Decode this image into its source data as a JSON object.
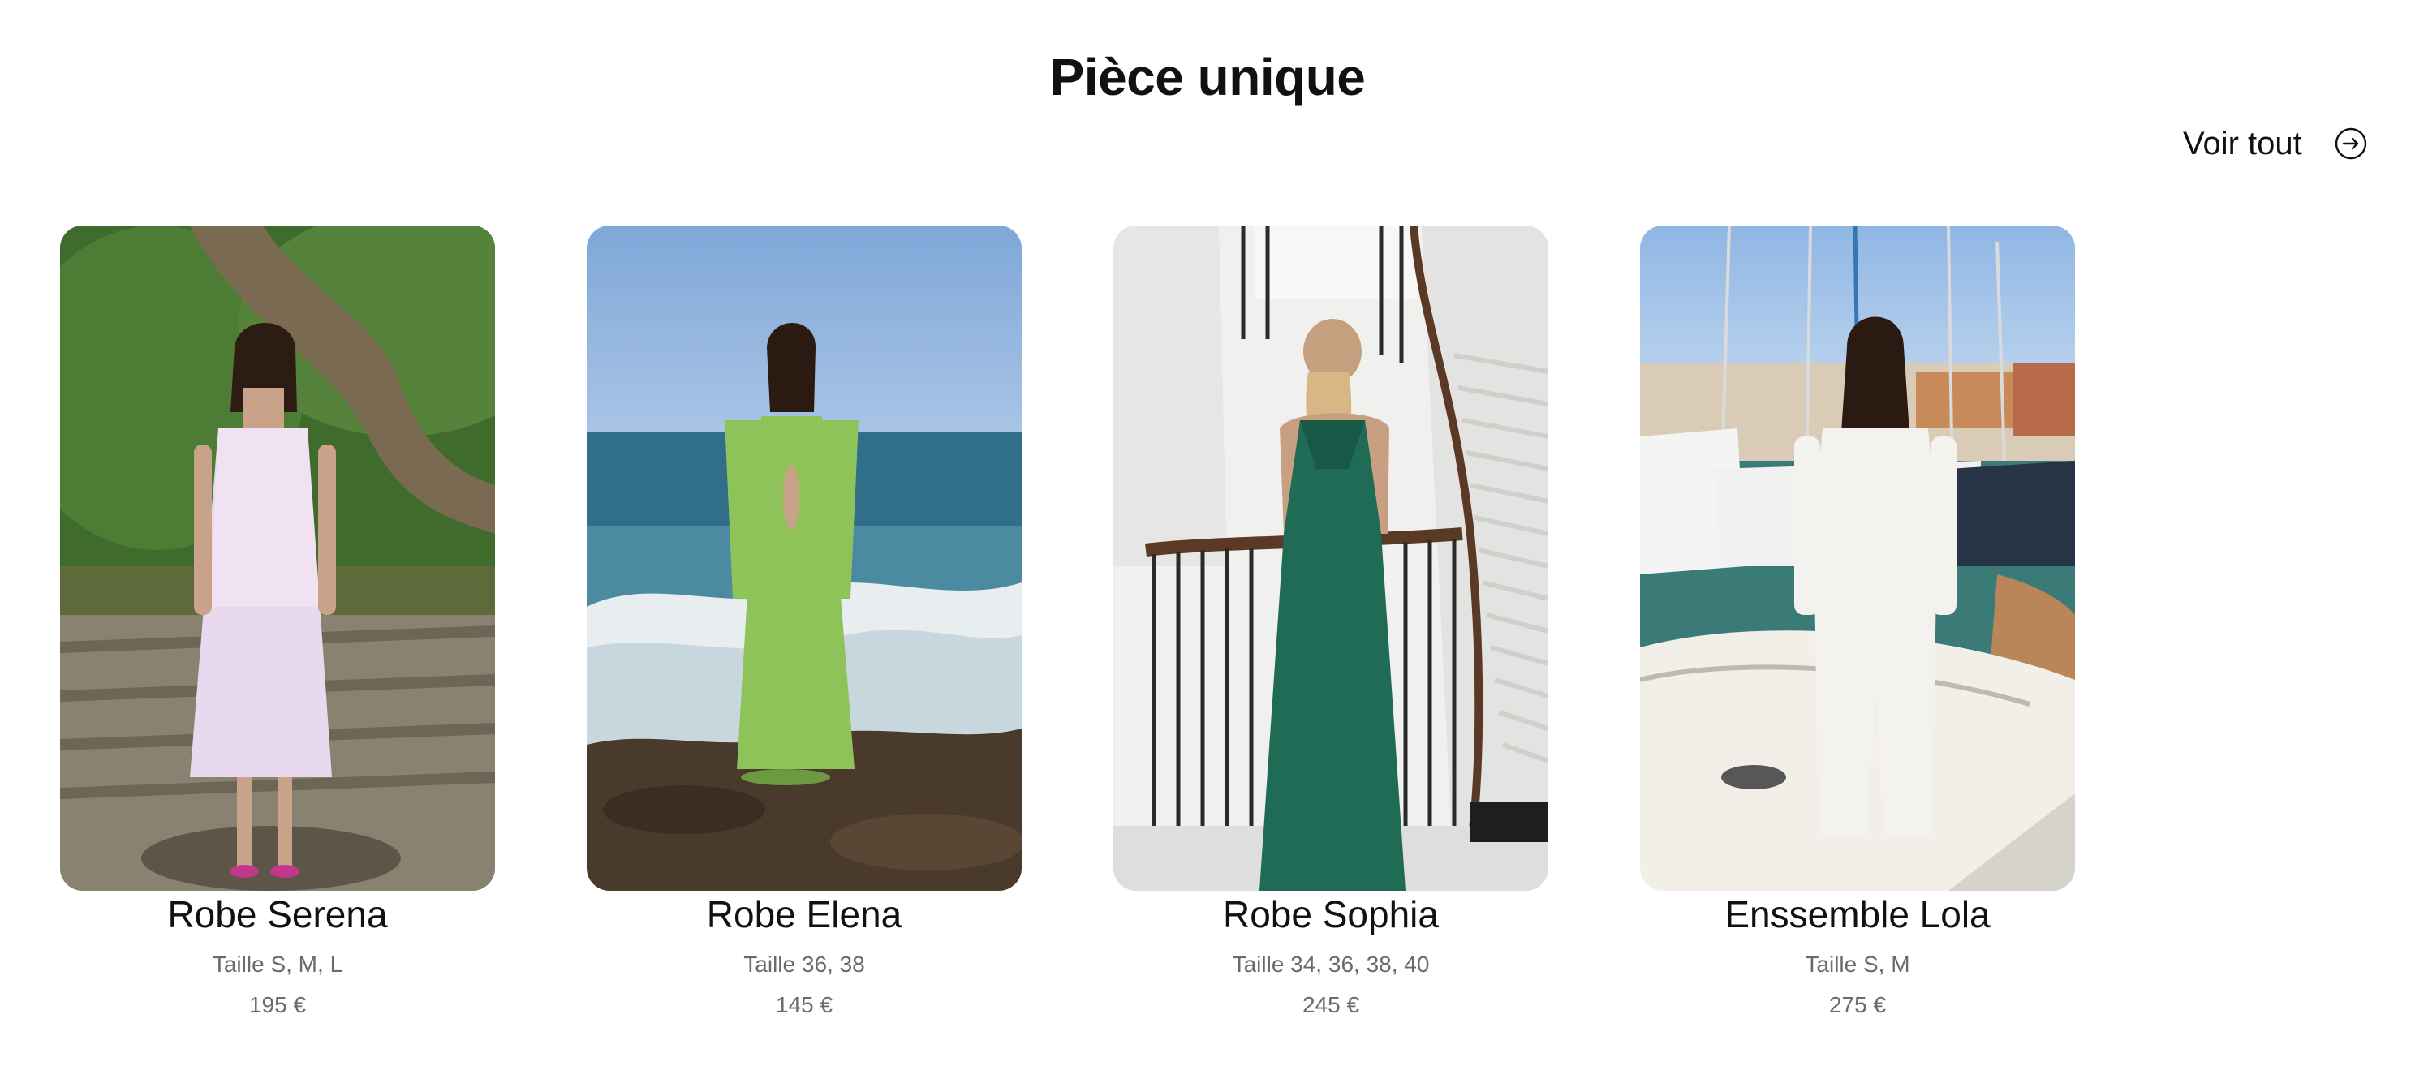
{
  "section": {
    "title": "Pièce unique",
    "see_all_label": "Voir tout",
    "see_all_icon": "arrow-right-circle-icon"
  },
  "products": [
    {
      "name": "Robe Serena",
      "sizes": "Taille S, M, L",
      "price": "195 €",
      "dress_color": "#e9d9ee"
    },
    {
      "name": "Robe Elena",
      "sizes": "Taille 36, 38",
      "price": "145 €",
      "dress_color": "#8ec35a"
    },
    {
      "name": "Robe Sophia",
      "sizes": "Taille 34, 36, 38, 40",
      "price": "245 €",
      "dress_color": "#1f6b55"
    },
    {
      "name": "Enssemble Lola",
      "sizes": "Taille S, M",
      "price": "275 €",
      "dress_color": "#f4f2ee"
    }
  ]
}
